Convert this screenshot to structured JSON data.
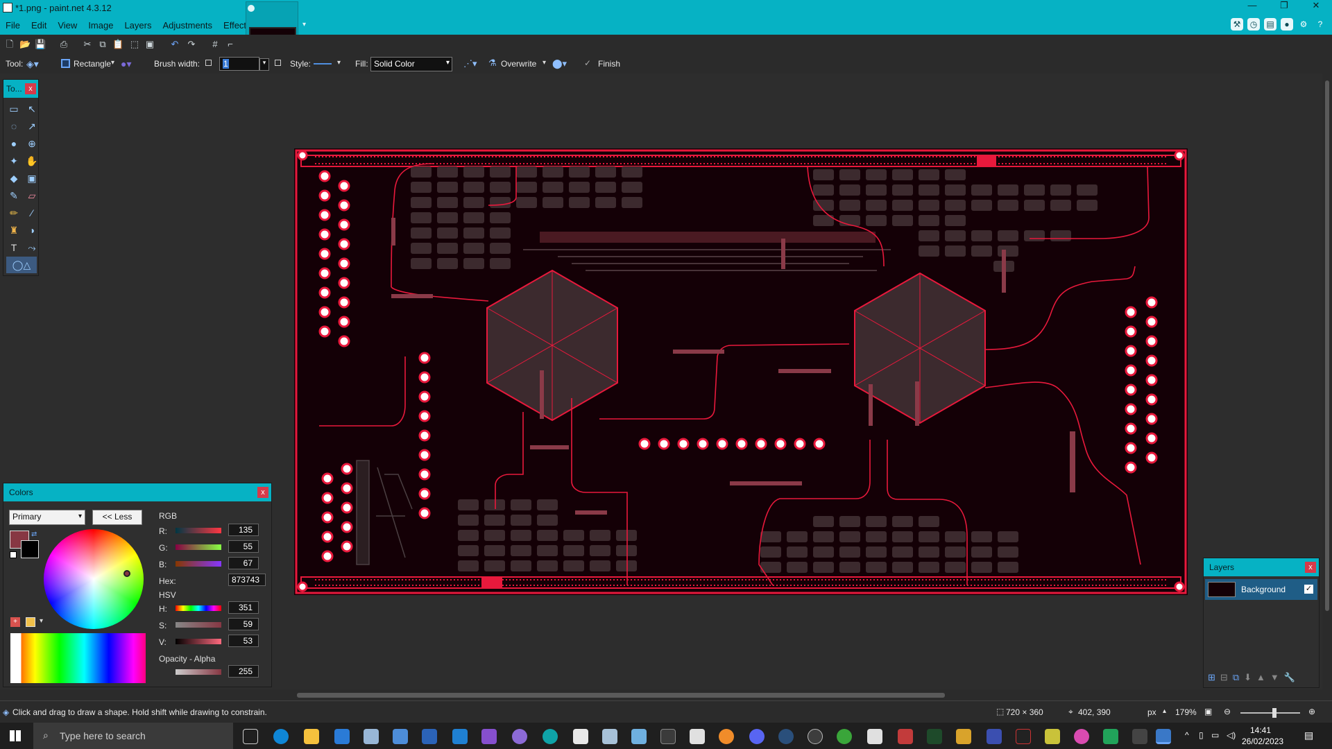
{
  "window": {
    "title": "*1.png - paint.net 4.3.12"
  },
  "menu": [
    "File",
    "Edit",
    "View",
    "Image",
    "Layers",
    "Adjustments",
    "Effects"
  ],
  "toolbar": {
    "tool_label": "Tool:",
    "shape": "Rectangle",
    "brush_width_label": "Brush width:",
    "brush_width_value": "1",
    "style_label": "Style:",
    "fill_label": "Fill:",
    "fill_value": "Solid Color",
    "blend_mode": "Overwrite",
    "finish_label": "Finish"
  },
  "tools_panel": {
    "title": "To...",
    "close": "x"
  },
  "colors_panel": {
    "title": "Colors",
    "close": "x",
    "selector": "Primary",
    "less_button": "<< Less",
    "rgb_label": "RGB",
    "r_label": "R:",
    "r_value": "135",
    "g_label": "G:",
    "g_value": "55",
    "b_label": "B:",
    "b_value": "67",
    "hex_label": "Hex:",
    "hex_value": "873743",
    "hsv_label": "HSV",
    "h_label": "H:",
    "h_value": "351",
    "s_label": "S:",
    "s_value": "59",
    "v_label": "V:",
    "v_value": "53",
    "alpha_label": "Opacity - Alpha",
    "alpha_value": "255",
    "primary_color": "#873743",
    "secondary_color": "#000000"
  },
  "layers_panel": {
    "title": "Layers",
    "close": "x",
    "layer_name": "Background",
    "visible": true
  },
  "status": {
    "hint": "Click and drag to draw a shape. Hold shift while drawing to constrain.",
    "image_size": "720 × 360",
    "cursor": "402, 390",
    "unit": "px",
    "zoom": "179%"
  },
  "taskbar": {
    "search_placeholder": "Type here to search",
    "time": "14:41",
    "date": "26/02/2023"
  },
  "colors": {
    "accent": "#06b2c4",
    "canvas_red": "#e8193c",
    "canvas_bg": "#140006"
  }
}
